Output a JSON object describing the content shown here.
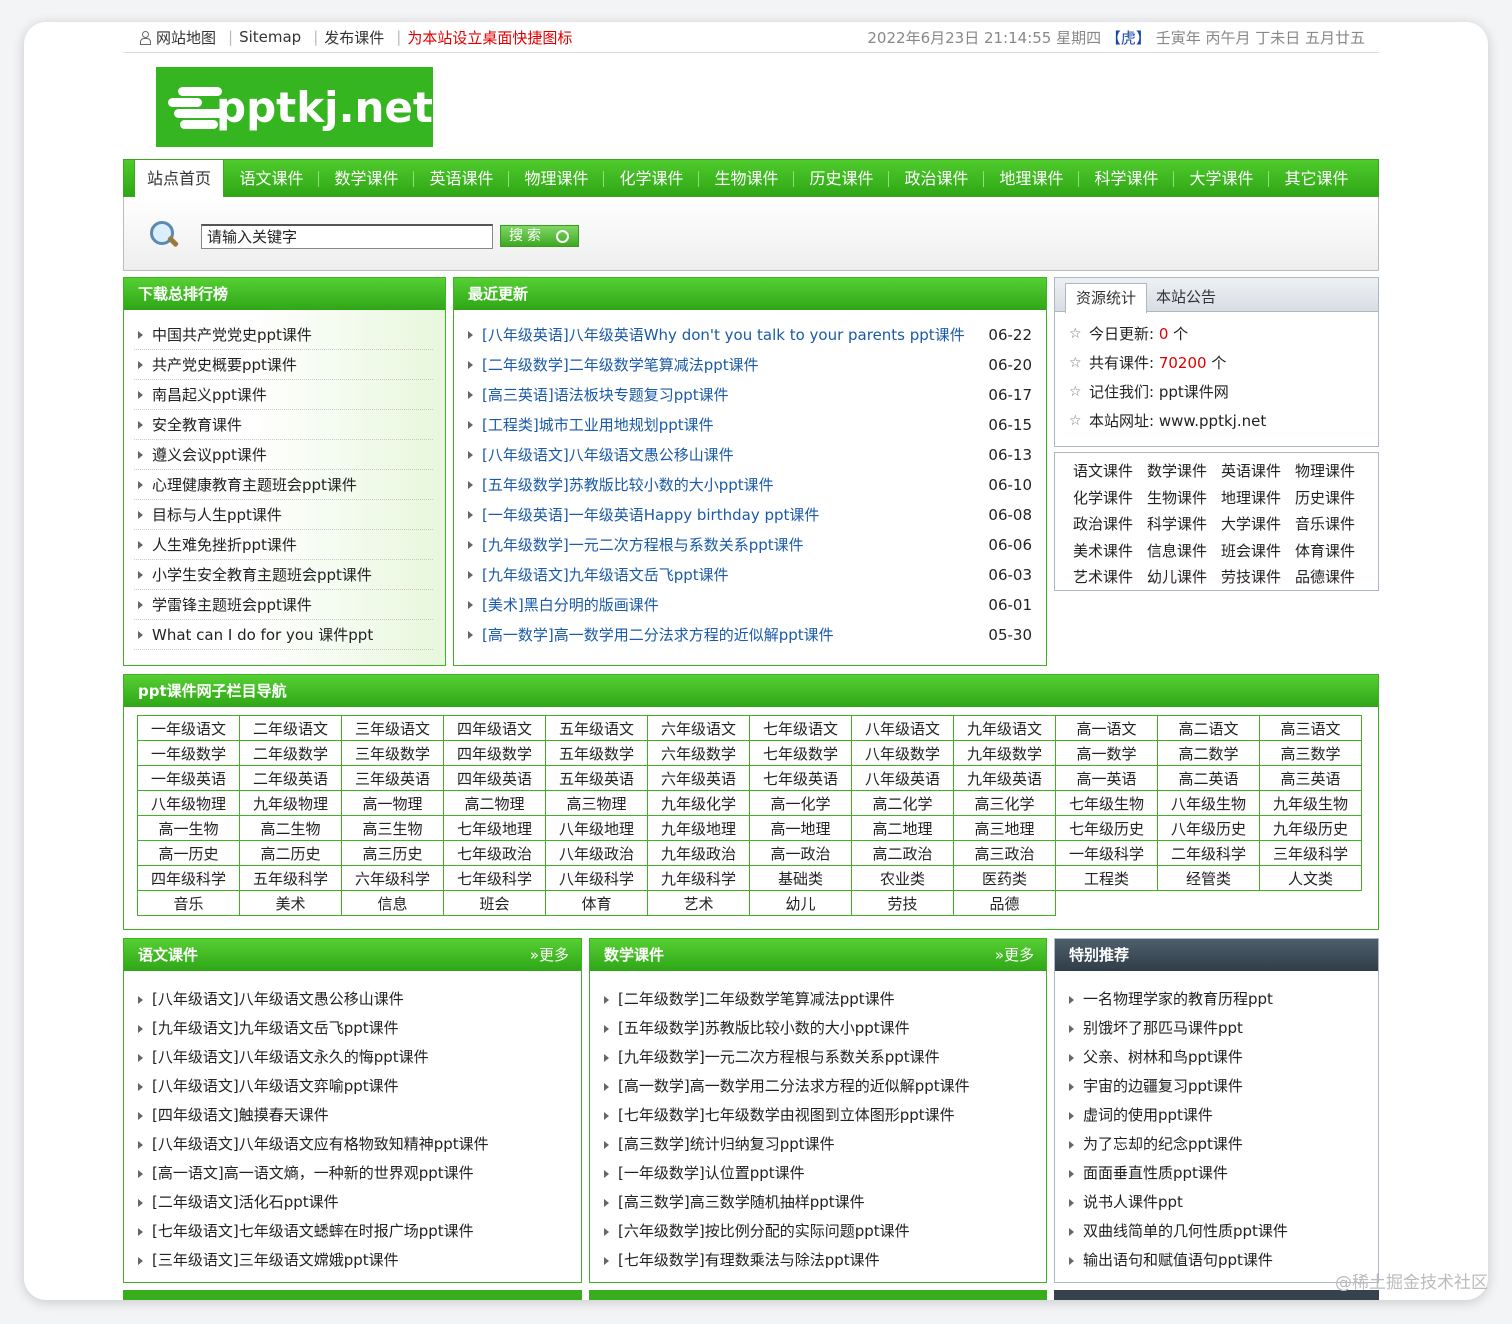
{
  "topbar": {
    "sitemap_cn": "网站地图",
    "sitemap_en": "Sitemap",
    "publish": "发布课件",
    "shortcut": "为本站设立桌面快捷图标",
    "datetime": "2022年6月23日 21:14:55 星期四",
    "zodiac": "【虎】",
    "lunar": "壬寅年 丙午月 丁未日 五月廿五"
  },
  "logo": {
    "text": "pptkj.net"
  },
  "nav": {
    "home": "站点首页",
    "items": [
      "语文课件",
      "数学课件",
      "英语课件",
      "物理课件",
      "化学课件",
      "生物课件",
      "历史课件",
      "政治课件",
      "地理课件",
      "科学课件",
      "大学课件",
      "其它课件"
    ]
  },
  "search": {
    "placeholder": "请输入关键字",
    "button": "搜索"
  },
  "ranking": {
    "title": "下载总排行榜",
    "items": [
      "中国共产党党史ppt课件",
      "共产党史概要ppt课件",
      "南昌起义ppt课件",
      "安全教育课件",
      "遵义会议ppt课件",
      "心理健康教育主题班会ppt课件",
      "目标与人生ppt课件",
      "人生难免挫折ppt课件",
      "小学生安全教育主题班会ppt课件",
      "学雷锋主题班会ppt课件",
      "What can I do for you 课件ppt"
    ]
  },
  "recent": {
    "title": "最近更新",
    "items": [
      {
        "text": "[八年级英语]八年级英语Why don't you talk to your parents ppt课件",
        "date": "06-22"
      },
      {
        "text": "[二年级数学]二年级数学笔算减法ppt课件",
        "date": "06-20"
      },
      {
        "text": "[高三英语]语法板块专题复习ppt课件",
        "date": "06-17"
      },
      {
        "text": "[工程类]城市工业用地规划ppt课件",
        "date": "06-15"
      },
      {
        "text": "[八年级语文]八年级语文愚公移山课件",
        "date": "06-13"
      },
      {
        "text": "[五年级数学]苏教版比较小数的大小ppt课件",
        "date": "06-10"
      },
      {
        "text": "[一年级英语]一年级英语Happy birthday ppt课件",
        "date": "06-08"
      },
      {
        "text": "[九年级数学]一元二次方程根与系数关系ppt课件",
        "date": "06-06"
      },
      {
        "text": "[九年级语文]九年级语文岳飞ppt课件",
        "date": "06-03"
      },
      {
        "text": "[美术]黑白分明的版画课件",
        "date": "06-01"
      },
      {
        "text": "[高一数学]高一数学用二分法求方程的近似解ppt课件",
        "date": "05-30"
      }
    ]
  },
  "stats": {
    "tab_active": "资源统计",
    "tab_other": "本站公告",
    "today_label": "今日更新:",
    "today_value": "0",
    "today_unit": "个",
    "total_label": "共有课件:",
    "total_value": "70200",
    "total_unit": "个",
    "remember_label": "记住我们:",
    "remember_value": "ppt课件网",
    "url_label": "本站网址:",
    "url_value": "www.pptkj.net"
  },
  "subjects": [
    "语文课件",
    "数学课件",
    "英语课件",
    "物理课件",
    "化学课件",
    "生物课件",
    "地理课件",
    "历史课件",
    "政治课件",
    "科学课件",
    "大学课件",
    "音乐课件",
    "美术课件",
    "信息课件",
    "班会课件",
    "体育课件",
    "艺术课件",
    "幼儿课件",
    "劳技课件",
    "品德课件"
  ],
  "column_nav": {
    "title": "ppt课件网子栏目导航",
    "rows": [
      [
        "一年级语文",
        "二年级语文",
        "三年级语文",
        "四年级语文",
        "五年级语文",
        "六年级语文",
        "七年级语文",
        "八年级语文",
        "九年级语文",
        "高一语文",
        "高二语文",
        "高三语文"
      ],
      [
        "一年级数学",
        "二年级数学",
        "三年级数学",
        "四年级数学",
        "五年级数学",
        "六年级数学",
        "七年级数学",
        "八年级数学",
        "九年级数学",
        "高一数学",
        "高二数学",
        "高三数学"
      ],
      [
        "一年级英语",
        "二年级英语",
        "三年级英语",
        "四年级英语",
        "五年级英语",
        "六年级英语",
        "七年级英语",
        "八年级英语",
        "九年级英语",
        "高一英语",
        "高二英语",
        "高三英语"
      ],
      [
        "八年级物理",
        "九年级物理",
        "高一物理",
        "高二物理",
        "高三物理",
        "九年级化学",
        "高一化学",
        "高二化学",
        "高三化学",
        "七年级生物",
        "八年级生物",
        "九年级生物"
      ],
      [
        "高一生物",
        "高二生物",
        "高三生物",
        "七年级地理",
        "八年级地理",
        "九年级地理",
        "高一地理",
        "高二地理",
        "高三地理",
        "七年级历史",
        "八年级历史",
        "九年级历史"
      ],
      [
        "高一历史",
        "高二历史",
        "高三历史",
        "七年级政治",
        "八年级政治",
        "九年级政治",
        "高一政治",
        "高二政治",
        "高三政治",
        "一年级科学",
        "二年级科学",
        "三年级科学"
      ],
      [
        "四年级科学",
        "五年级科学",
        "六年级科学",
        "七年级科学",
        "八年级科学",
        "九年级科学",
        "基础类",
        "农业类",
        "医药类",
        "工程类",
        "经管类",
        "人文类"
      ],
      [
        "音乐",
        "美术",
        "信息",
        "班会",
        "体育",
        "艺术",
        "幼儿",
        "劳技",
        "品德"
      ]
    ]
  },
  "chinese": {
    "title": "语文课件",
    "more": "»更多",
    "items": [
      "[八年级语文]八年级语文愚公移山课件",
      "[九年级语文]九年级语文岳飞ppt课件",
      "[八年级语文]八年级语文永久的悔ppt课件",
      "[八年级语文]八年级语文弈喻ppt课件",
      "[四年级语文]触摸春天课件",
      "[八年级语文]八年级语文应有格物致知精神ppt课件",
      "[高一语文]高一语文熵，一种新的世界观ppt课件",
      "[二年级语文]活化石ppt课件",
      "[七年级语文]七年级语文蟋蟀在时报广场ppt课件",
      "[三年级语文]三年级语文嫦娥ppt课件"
    ]
  },
  "math": {
    "title": "数学课件",
    "more": "»更多",
    "items": [
      "[二年级数学]二年级数学笔算减法ppt课件",
      "[五年级数学]苏教版比较小数的大小ppt课件",
      "[九年级数学]一元二次方程根与系数关系ppt课件",
      "[高一数学]高一数学用二分法求方程的近似解ppt课件",
      "[七年级数学]七年级数学由视图到立体图形ppt课件",
      "[高三数学]统计归纳复习ppt课件",
      "[一年级数学]认位置ppt课件",
      "[高三数学]高三数学随机抽样ppt课件",
      "[六年级数学]按比例分配的实际问题ppt课件",
      "[七年级数学]有理数乘法与除法ppt课件"
    ]
  },
  "special": {
    "title": "特别推荐",
    "items": [
      "一名物理学家的教育历程ppt",
      "别饿坏了那匹马课件ppt",
      "父亲、树林和鸟ppt课件",
      "宇宙的边疆复习ppt课件",
      "虚词的使用ppt课件",
      "为了忘却的纪念ppt课件",
      "面面垂直性质ppt课件",
      "说书人课件ppt",
      "双曲线简单的几何性质ppt课件",
      "输出语句和赋值语句ppt课件"
    ]
  },
  "watermark": "@稀土掘金技术社区"
}
